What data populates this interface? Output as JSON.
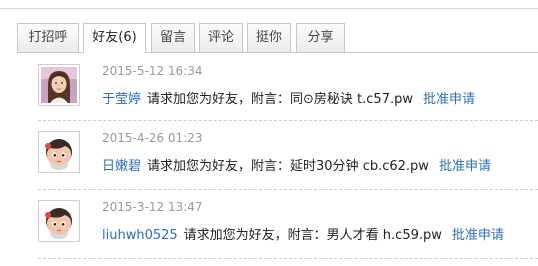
{
  "tabs": [
    {
      "label": "打招呼"
    },
    {
      "label": "好友(6)"
    },
    {
      "label": "留言"
    },
    {
      "label": "评论"
    },
    {
      "label": "挺你"
    },
    {
      "label": "分享"
    }
  ],
  "requests": [
    {
      "avatar_icon": "girl-photo-avatar",
      "time": "2015-5-12 16:34",
      "user": "于莹婷",
      "message": "请求加您为好友，附言：同⊙房秘诀 t.c57.pw",
      "action": "批准申请"
    },
    {
      "avatar_icon": "cartoon-boy-avatar",
      "time": "2015-4-26 01:23",
      "user": "日嫩碧",
      "message": "请求加您为好友，附言：延时30分钟 cb.c62.pw",
      "action": "批准申请"
    },
    {
      "avatar_icon": "cartoon-boy-avatar",
      "time": "2015-3-12 13:47",
      "user": "liuhwh0525",
      "message": "请求加您为好友，附言：男人才看 h.c59.pw",
      "action": "批准申请"
    }
  ]
}
